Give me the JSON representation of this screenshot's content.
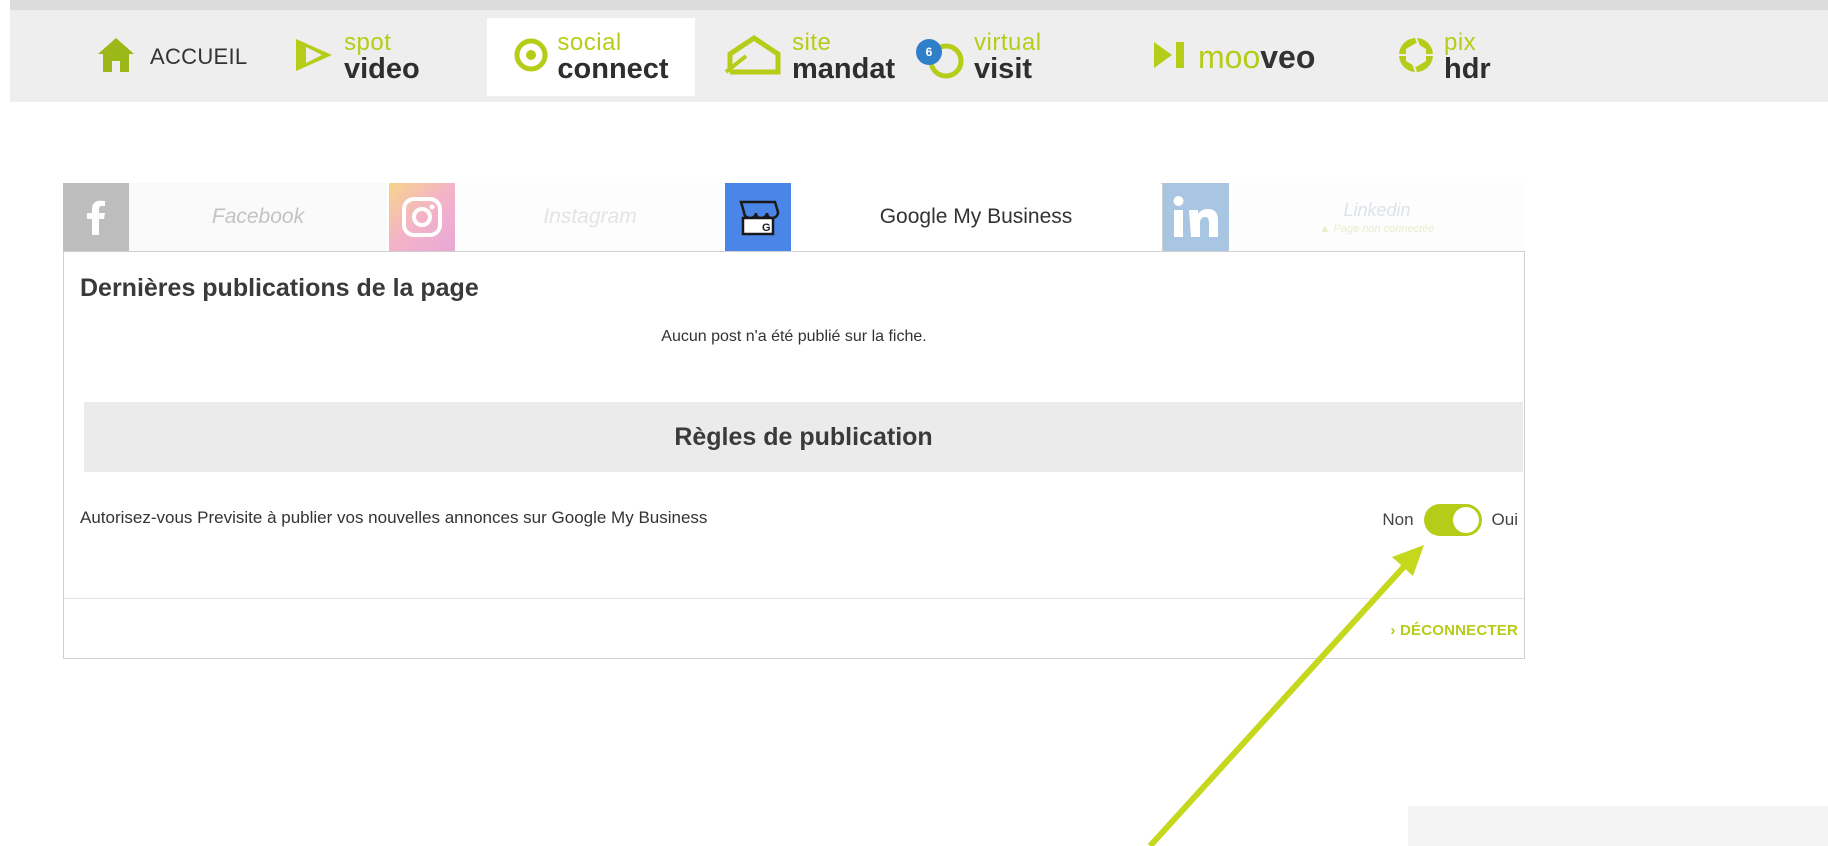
{
  "topnav": {
    "accueil_label": "ACCUEIL",
    "spot_video": {
      "light": "spot",
      "bold": "video"
    },
    "social_connect": {
      "light": "social",
      "bold": "connect"
    },
    "site_mandat": {
      "light": "site",
      "bold": "mandat"
    },
    "virtual_visit": {
      "light": "virtual",
      "bold": "visit",
      "badge": "6"
    },
    "mooveo": {
      "light": "moo",
      "bold": "veo"
    },
    "pix_hdr": {
      "light": "pix",
      "bold": "hdr"
    }
  },
  "tabs": {
    "facebook": "Facebook",
    "instagram": "Instagram",
    "google": "Google My Business",
    "linkedin": "Linkedin",
    "linkedin_status": "▲ Page non connectée"
  },
  "panel": {
    "title": "Dernières publications de la page",
    "no_post": "Aucun post n'a été publié sur la fiche.",
    "rules_title": "Règles de publication",
    "rule_text": "Autorisez-vous Previsite à publier vos nouvelles annonces sur Google My Business",
    "toggle_off": "Non",
    "toggle_on": "Oui",
    "toggle_state": true,
    "disconnect": "› DÉCONNECTER"
  },
  "colors": {
    "accent": "#b5cc18",
    "facebook_bg": "#bdbdbd",
    "google_blue": "#4a86e8",
    "linkedin_blue": "#a8c6e2"
  }
}
